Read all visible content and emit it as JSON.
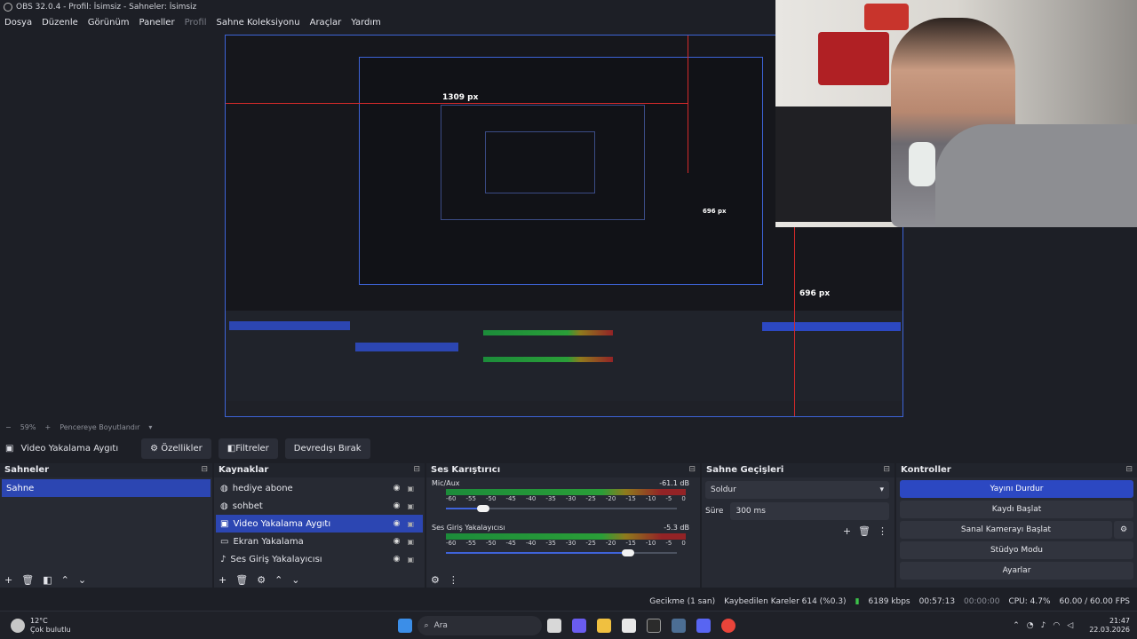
{
  "window": {
    "title": "OBS 32.0.4 - Profil: İsimsiz - Sahneler: İsimsiz"
  },
  "menu": [
    "Dosya",
    "Düzenle",
    "Görünüm",
    "Paneller",
    "Profil",
    "Sahne Koleksiyonu",
    "Araçlar",
    "Yardım"
  ],
  "preview": {
    "measure_width": "1309 px",
    "measure_height": "696 px",
    "measure_height_outer": "696 px"
  },
  "zoom": {
    "minus": "−",
    "value": "59%",
    "plus": "+",
    "mode": "Pencereye Boyutlandır"
  },
  "source_toolbar": {
    "current": "Video Yakalama Aygıtı",
    "properties": "Özellikler",
    "filters": "Filtreler",
    "deactivate": "Devredışı Bırak"
  },
  "scenes": {
    "title": "Sahneler",
    "items": [
      "Sahne"
    ]
  },
  "sources": {
    "title": "Kaynaklar",
    "items": [
      "hediye abone",
      "sohbet",
      "Video Yakalama Aygıtı",
      "Ekran Yakalama",
      "Ses Giriş Yakalayıcısı"
    ]
  },
  "mixer": {
    "title": "Ses Karıştırıcı",
    "channels": [
      {
        "name": "Mic/Aux",
        "db": "-61.1 dB",
        "level": 0.16
      },
      {
        "name": "Ses Giriş Yakalayıcısı",
        "db": "-5.3 dB",
        "level": 0.79
      }
    ],
    "ticks": [
      "-60",
      "-55",
      "-50",
      "-45",
      "-40",
      "-35",
      "-30",
      "-25",
      "-20",
      "-15",
      "-10",
      "-5",
      "0"
    ]
  },
  "transitions": {
    "title": "Sahne Geçişleri",
    "selected": "Soldur",
    "duration_label": "Süre",
    "duration": "300 ms"
  },
  "controls": {
    "title": "Kontroller",
    "items": [
      "Yayını Durdur",
      "Kaydı Başlat",
      "Sanal Kamerayı Başlat",
      "Stüdyo Modu",
      "Ayarlar"
    ]
  },
  "status": {
    "delay": "Gecikme (1 san)",
    "dropped": "Kaybedilen Kareler 614 (%0.3)",
    "bitrate": "6189 kbps",
    "stream_time": "00:57:13",
    "rec_time": "00:00:00",
    "cpu": "CPU: 4.7%",
    "fps": "60.00 / 60.00 FPS"
  },
  "taskbar": {
    "weather_temp": "12°C",
    "weather_desc": "Çok bulutlu",
    "search": "Ara",
    "time": "21:47",
    "date": "22.03.2026"
  },
  "colors": {
    "accent": "#2c46b2",
    "bg": "#1d1f26",
    "panel": "#272a33",
    "border": "#3d64d8",
    "measure": "#d42a2a"
  }
}
